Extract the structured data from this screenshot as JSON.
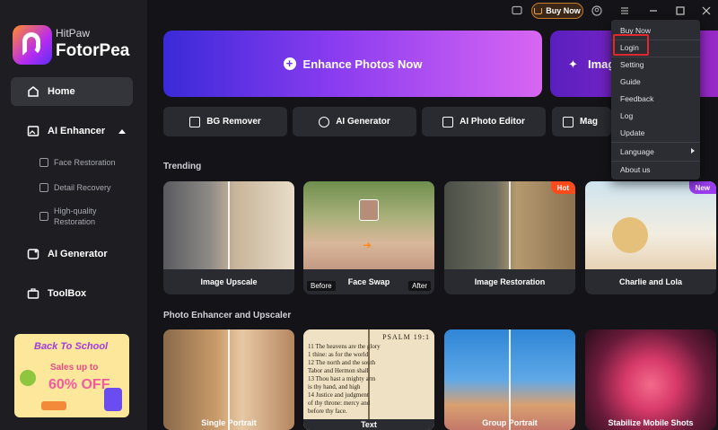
{
  "brand": {
    "line1": "HitPaw",
    "line2": "FotorPea"
  },
  "sidebar": {
    "items": [
      {
        "label": "Home"
      },
      {
        "label": "AI Enhancer"
      },
      {
        "label": "AI Generator"
      },
      {
        "label": "ToolBox"
      }
    ],
    "sub_items": [
      {
        "label": "Face Restoration"
      },
      {
        "label": "Detail Recovery"
      },
      {
        "label": "High-quality Restoration"
      }
    ],
    "promo": {
      "line1": "Back To School",
      "line2": "Sales up to",
      "line3": "60% OFF"
    }
  },
  "topbar": {
    "buy_label": "Buy Now"
  },
  "banners": {
    "main": "Enhance Photos Now",
    "second": "Imag"
  },
  "tools": [
    "BG Remover",
    "AI Generator",
    "AI Photo Editor",
    "Mag"
  ],
  "trending": {
    "title": "Trending",
    "cards": [
      {
        "label": "Image Upscale",
        "badge": ""
      },
      {
        "label": "Face Swap",
        "badge": "",
        "before": "Before",
        "after": "After"
      },
      {
        "label": "Image Restoration",
        "badge": "Hot"
      },
      {
        "label": "Charlie and Lola",
        "badge": "New"
      }
    ]
  },
  "enhancer": {
    "title": "Photo Enhancer and Upscaler",
    "cards": [
      {
        "label": "Single Portrait"
      },
      {
        "label": "Text",
        "heading": "PSALM 19:1",
        "lines": [
          "11 The heavens are the glory",
          "1 thine: as for the world",
          "12 The north and the south",
          "Tabor and Hermon shall",
          "13 Thou hast a mighty arm",
          "is thy hand, and high",
          "14 Justice and judgment",
          "of thy throne: mercy and",
          "before thy face."
        ]
      },
      {
        "label": "Group Portrait"
      },
      {
        "label": "Stabilize Mobile Shots"
      }
    ]
  },
  "menu": {
    "items": [
      "Buy Now",
      "Login",
      "Setting",
      "Guide",
      "Feedback",
      "Log",
      "Update",
      "Language",
      "About us"
    ]
  },
  "colors": {
    "accent_purple": "#8a3cf0",
    "hot": "#ff4a1c",
    "new": "#9a3cf0",
    "highlight": "#e0282e"
  }
}
